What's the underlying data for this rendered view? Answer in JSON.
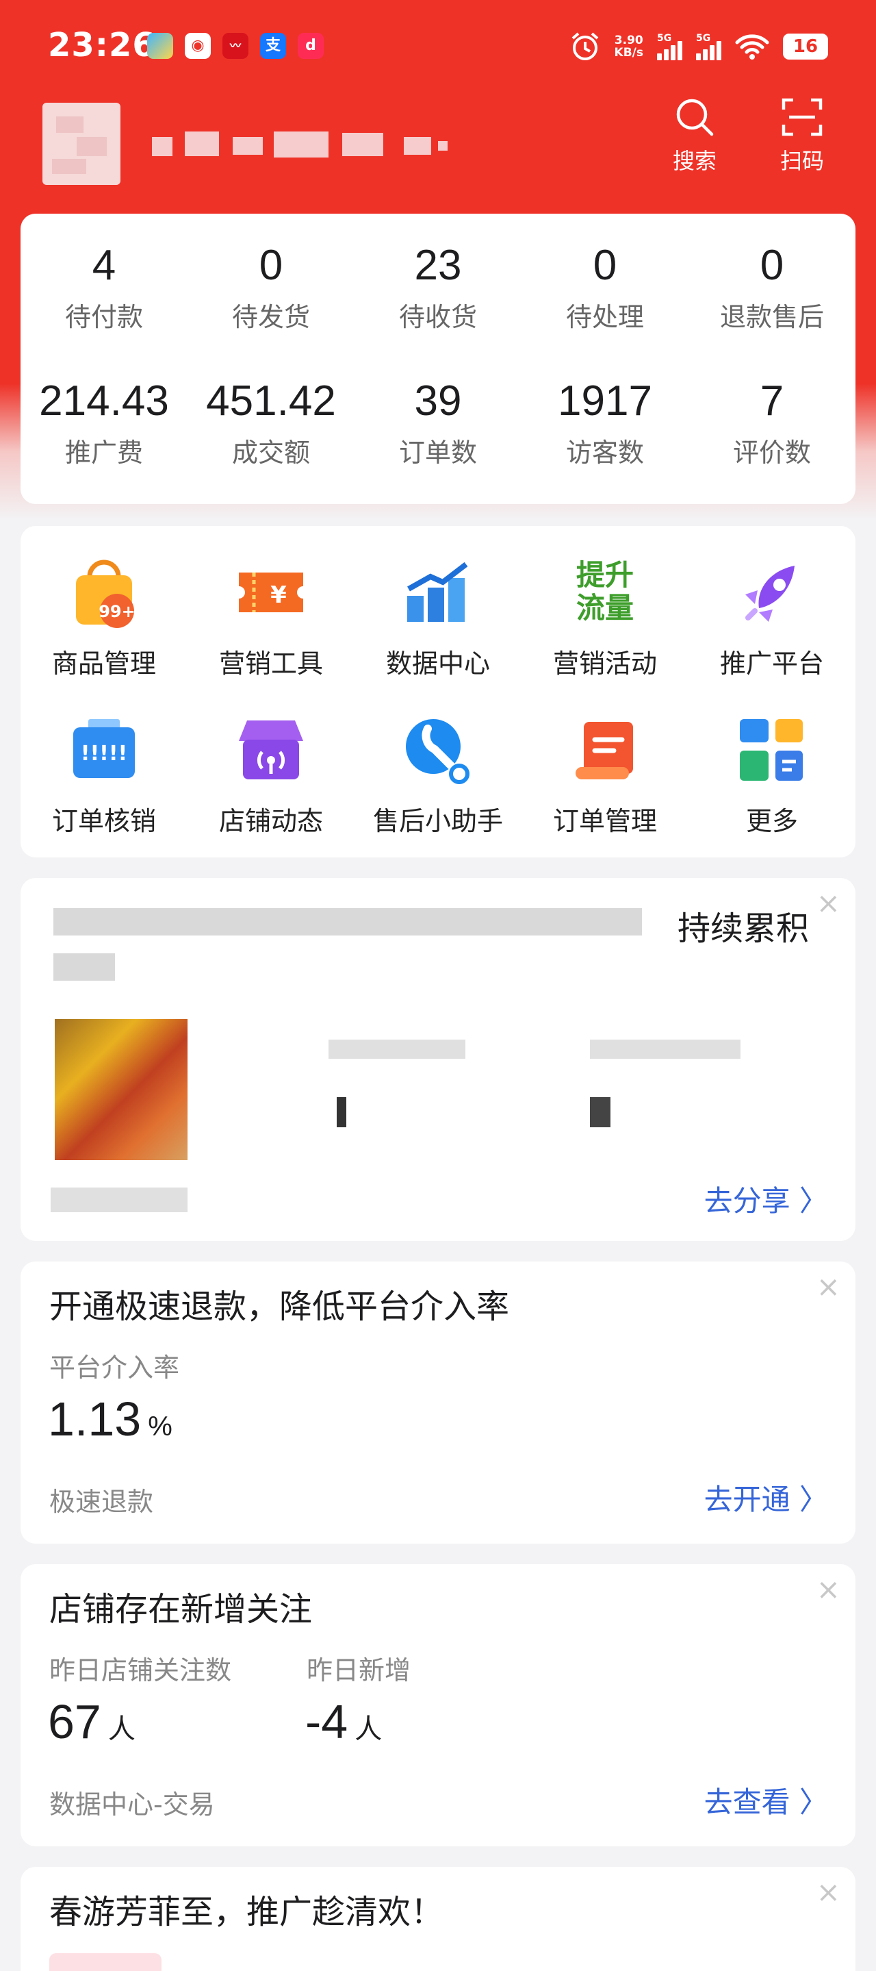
{
  "status_bar": {
    "time": "23:26",
    "net_speed": "3.90\nKB/s",
    "sig1_label": "5G",
    "sig2_label": "5G",
    "battery": "16",
    "app_alipay": "支",
    "app_douyin": "d"
  },
  "header": {
    "search_label": "搜索",
    "scan_label": "扫码"
  },
  "order_stats": [
    {
      "value": "4",
      "label": "待付款"
    },
    {
      "value": "0",
      "label": "待发货"
    },
    {
      "value": "23",
      "label": "待收货"
    },
    {
      "value": "0",
      "label": "待处理"
    },
    {
      "value": "0",
      "label": "退款售后"
    }
  ],
  "biz_stats": [
    {
      "value": "214.43",
      "label": "推广费"
    },
    {
      "value": "451.42",
      "label": "成交额"
    },
    {
      "value": "39",
      "label": "订单数"
    },
    {
      "value": "1917",
      "label": "访客数"
    },
    {
      "value": "7",
      "label": "评价数"
    }
  ],
  "tools": [
    {
      "label": "商品管理",
      "icon": "shopping-bag-icon",
      "badge": "99+"
    },
    {
      "label": "营销工具",
      "icon": "coupon-ticket-icon",
      "badge": "¥"
    },
    {
      "label": "数据中心",
      "icon": "bar-chart-icon"
    },
    {
      "label": "营销活动",
      "icon": "boost-traffic-icon",
      "badge": "提升\n流量"
    },
    {
      "label": "推广平台",
      "icon": "rocket-icon"
    },
    {
      "label": "订单核销",
      "icon": "ticket-scanner-icon",
      "badge": "!!!!!"
    },
    {
      "label": "店铺动态",
      "icon": "storefront-broadcast-icon"
    },
    {
      "label": "售后小助手",
      "icon": "wrench-icon"
    },
    {
      "label": "订单管理",
      "icon": "scroll-document-icon"
    },
    {
      "label": "更多",
      "icon": "more-grid-icon"
    }
  ],
  "card_share": {
    "title_tail": "持续累积",
    "link": "去分享"
  },
  "card_refund": {
    "title": "开通极速退款，降低平台介入率",
    "metric_label": "平台介入率",
    "metric_value": "1.13",
    "metric_unit": "%",
    "footer": "极速退款",
    "link": "去开通"
  },
  "card_follow": {
    "title": "店铺存在新增关注",
    "m1_label": "昨日店铺关注数",
    "m1_value": "67",
    "m1_unit": "人",
    "m2_label": "昨日新增",
    "m2_value": "-4",
    "m2_unit": "人",
    "footer": "数据中心-交易",
    "link": "去查看"
  },
  "card_promo": {
    "title": "春游芳菲至，推广趁清欢！"
  },
  "colors": {
    "brand_red": "#ee3228",
    "link_blue": "#3565d8"
  }
}
